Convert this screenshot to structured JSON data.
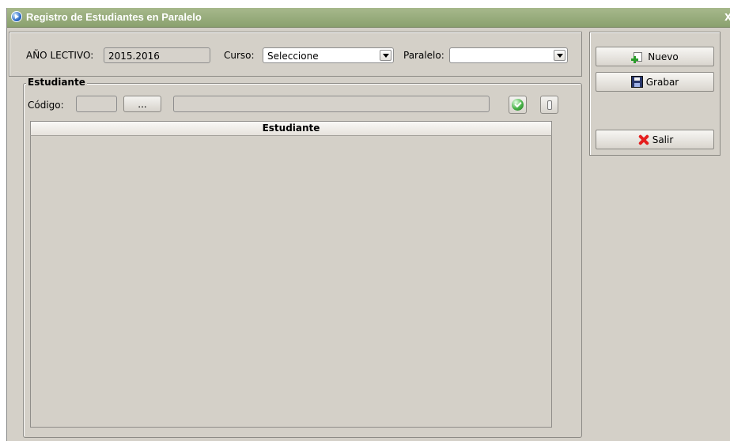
{
  "window": {
    "title": "Registro de Estudiantes en Paralelo",
    "close": "X"
  },
  "filters": {
    "year_label": "AÑO LECTIVO:",
    "year_value": "2015.2016",
    "course_label": "Curso:",
    "course_selected": "Seleccione",
    "paralelo_label": "Paralelo:",
    "paralelo_selected": ""
  },
  "student_group": {
    "legend": "Estudiante",
    "code_label": "Código:",
    "code_value": "",
    "lookup_button": "...",
    "student_name": ""
  },
  "table": {
    "header": "Estudiante",
    "rows": []
  },
  "actions": {
    "new_label": "Nuevo",
    "save_label": "Grabar",
    "exit_label": "Salir"
  },
  "icons": {
    "window": "window-icon",
    "new": "new-document-icon",
    "save": "save-icon",
    "exit": "exit-icon",
    "confirm": "check-icon",
    "clear": "clipboard-icon"
  },
  "colors": {
    "titlebar": "#8aa16e",
    "panel": "#d4d0c8",
    "accent_green": "#2b9c2b",
    "exit_red": "#e51e1e"
  }
}
